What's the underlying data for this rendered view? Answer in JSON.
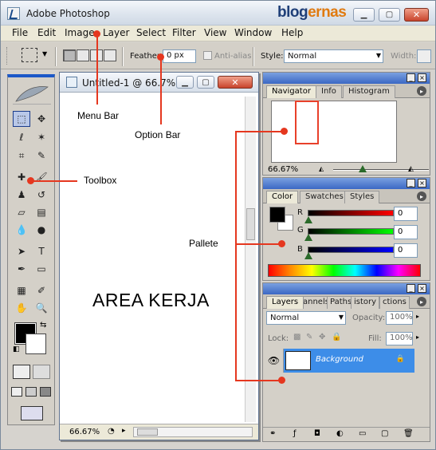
{
  "window": {
    "title": "Adobe Photoshop",
    "brand_part1": "blog",
    "brand_part2": "ernas",
    "accent_color": "#1c58c8",
    "annotation_color": "#e5371f"
  },
  "menubar": {
    "items": [
      "File",
      "Edit",
      "Image",
      "Layer",
      "Select",
      "Filter",
      "View",
      "Window",
      "Help"
    ]
  },
  "optionbar": {
    "feather_label": "Feather:",
    "feather_value": "0 px",
    "antialias_label": "Anti-alias",
    "style_label": "Style:",
    "style_value": "Normal",
    "width_label": "Width:"
  },
  "document": {
    "title": "Untitled-1 @ 66.7%...",
    "zoom": "66.67%",
    "body_text": "AREA KERJA"
  },
  "navigator": {
    "tabs": [
      "Navigator",
      "Info",
      "Histogram"
    ],
    "zoom": "66.67%"
  },
  "color_panel": {
    "tabs": [
      "Color",
      "Swatches",
      "Styles"
    ],
    "channels": [
      {
        "label": "R",
        "value": "0"
      },
      {
        "label": "G",
        "value": "0"
      },
      {
        "label": "B",
        "value": "0"
      }
    ]
  },
  "layers_panel": {
    "tabs": [
      "Layers",
      "annels",
      "Paths",
      "istory",
      "ctions"
    ],
    "blend_mode": "Normal",
    "opacity_label": "Opacity:",
    "opacity_value": "100%",
    "lock_label": "Lock:",
    "fill_label": "Fill:",
    "fill_value": "100%",
    "layer_name": "Background"
  },
  "annotations": {
    "menu_bar": "Menu Bar",
    "option_bar": "Option Bar",
    "toolbox": "Toolbox",
    "pallete": "Pallete"
  }
}
